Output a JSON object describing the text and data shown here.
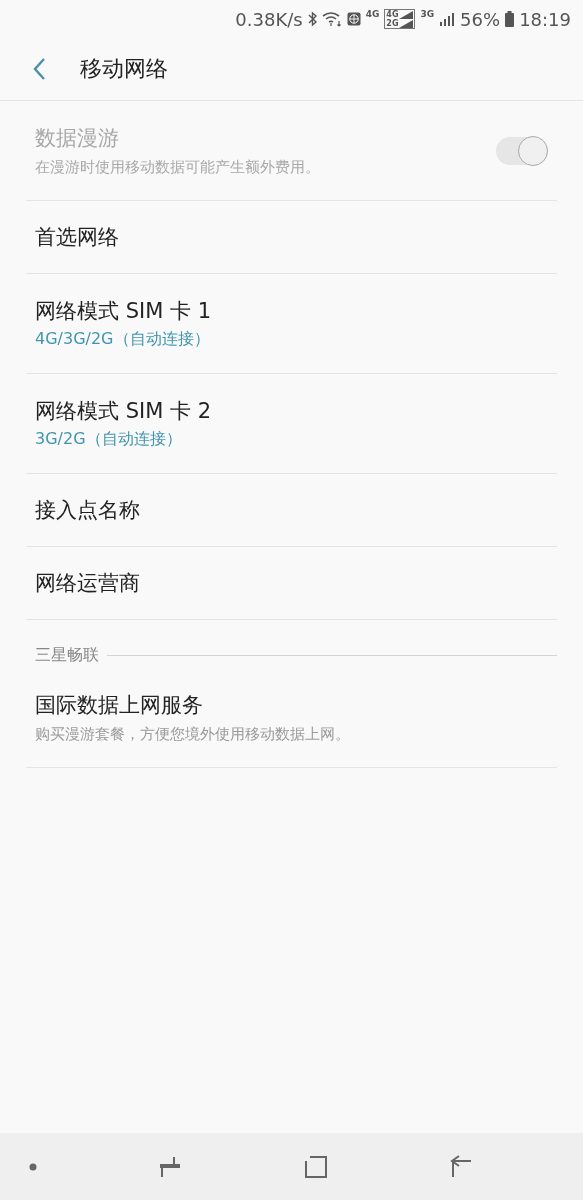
{
  "status_bar": {
    "speed": "0.38K/s",
    "net_a": "4G",
    "net_box_top": "4G",
    "net_box_bottom": "2G",
    "net_b": "3G",
    "battery": "56%",
    "time": "18:19"
  },
  "header": {
    "title": "移动网络"
  },
  "items": [
    {
      "kind": "toggle",
      "title": "数据漫游",
      "subtitle": "在漫游时使用移动数据可能产生额外费用。",
      "checked": true,
      "disabled": true
    },
    {
      "kind": "plain",
      "title": "首选网络"
    },
    {
      "kind": "value",
      "title": "网络模式 SIM 卡 1",
      "value": "4G/3G/2G（自动连接）"
    },
    {
      "kind": "value",
      "title": "网络模式 SIM 卡 2",
      "value": "3G/2G（自动连接）"
    },
    {
      "kind": "plain",
      "title": "接入点名称"
    },
    {
      "kind": "plain",
      "title": "网络运营商"
    },
    {
      "kind": "section",
      "title": "三星畅联"
    },
    {
      "kind": "desc",
      "title": "国际数据上网服务",
      "subtitle": "购买漫游套餐，方便您境外使用移动数据上网。"
    }
  ]
}
